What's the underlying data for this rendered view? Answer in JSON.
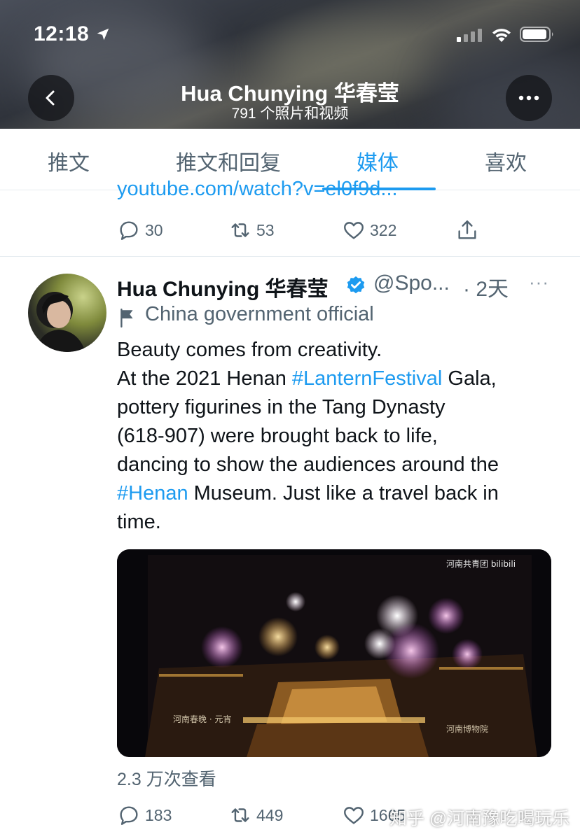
{
  "status_bar": {
    "time": "12:18",
    "icons": [
      "location-arrow-icon",
      "cellular-signal-icon",
      "wifi-icon",
      "battery-icon"
    ]
  },
  "header": {
    "title": "Hua Chunying 华春莹",
    "subtitle": "791 个照片和视频",
    "back_icon": "chevron-left-icon",
    "more_icon": "more-horizontal-icon"
  },
  "tabs": [
    {
      "label": "推文",
      "active": false
    },
    {
      "label": "推文和回复",
      "active": false
    },
    {
      "label": "媒体",
      "active": true
    },
    {
      "label": "喜欢",
      "active": false
    }
  ],
  "previous_tweet": {
    "link_text": "youtube.com/watch?v=el0f9d...",
    "replies": "30",
    "retweets": "53",
    "likes": "322"
  },
  "tweet": {
    "author_name": "Hua Chunying 华春莹",
    "handle": "@Spo...",
    "time": "· 2天",
    "more": "···",
    "account_label": "China government official",
    "text_lines": [
      {
        "parts": [
          {
            "t": "Beauty comes from creativity.",
            "tag": false
          }
        ]
      },
      {
        "parts": [
          {
            "t": "At the 2021 Henan ",
            "tag": false
          },
          {
            "t": "#LanternFestival",
            "tag": true
          },
          {
            "t": " Gala,",
            "tag": false
          }
        ]
      },
      {
        "parts": [
          {
            "t": "pottery figurines in the Tang Dynasty",
            "tag": false
          }
        ]
      },
      {
        "parts": [
          {
            "t": "(618-907) were brought back to life,",
            "tag": false
          }
        ]
      },
      {
        "parts": [
          {
            "t": "dancing to show the audiences around the",
            "tag": false
          }
        ]
      },
      {
        "parts": [
          {
            "t": "#Henan",
            "tag": true
          },
          {
            "t": " Museum. Just like a travel back in",
            "tag": false
          }
        ]
      },
      {
        "parts": [
          {
            "t": "time.",
            "tag": false
          }
        ]
      }
    ],
    "media": {
      "overlay_top_right": "河南共青团 bilibili",
      "overlay_bottom_left": "河南春晚 · 元宵",
      "overlay_bottom_right": "河南博物院"
    },
    "views": "2.3 万次查看",
    "replies": "183",
    "retweets": "449",
    "likes": "1665"
  },
  "watermark": "知乎 @河南豫吃喝玩乐",
  "colors": {
    "accent": "#1d9bf0",
    "secondary_text": "#536471",
    "primary_text": "#0f1419"
  }
}
